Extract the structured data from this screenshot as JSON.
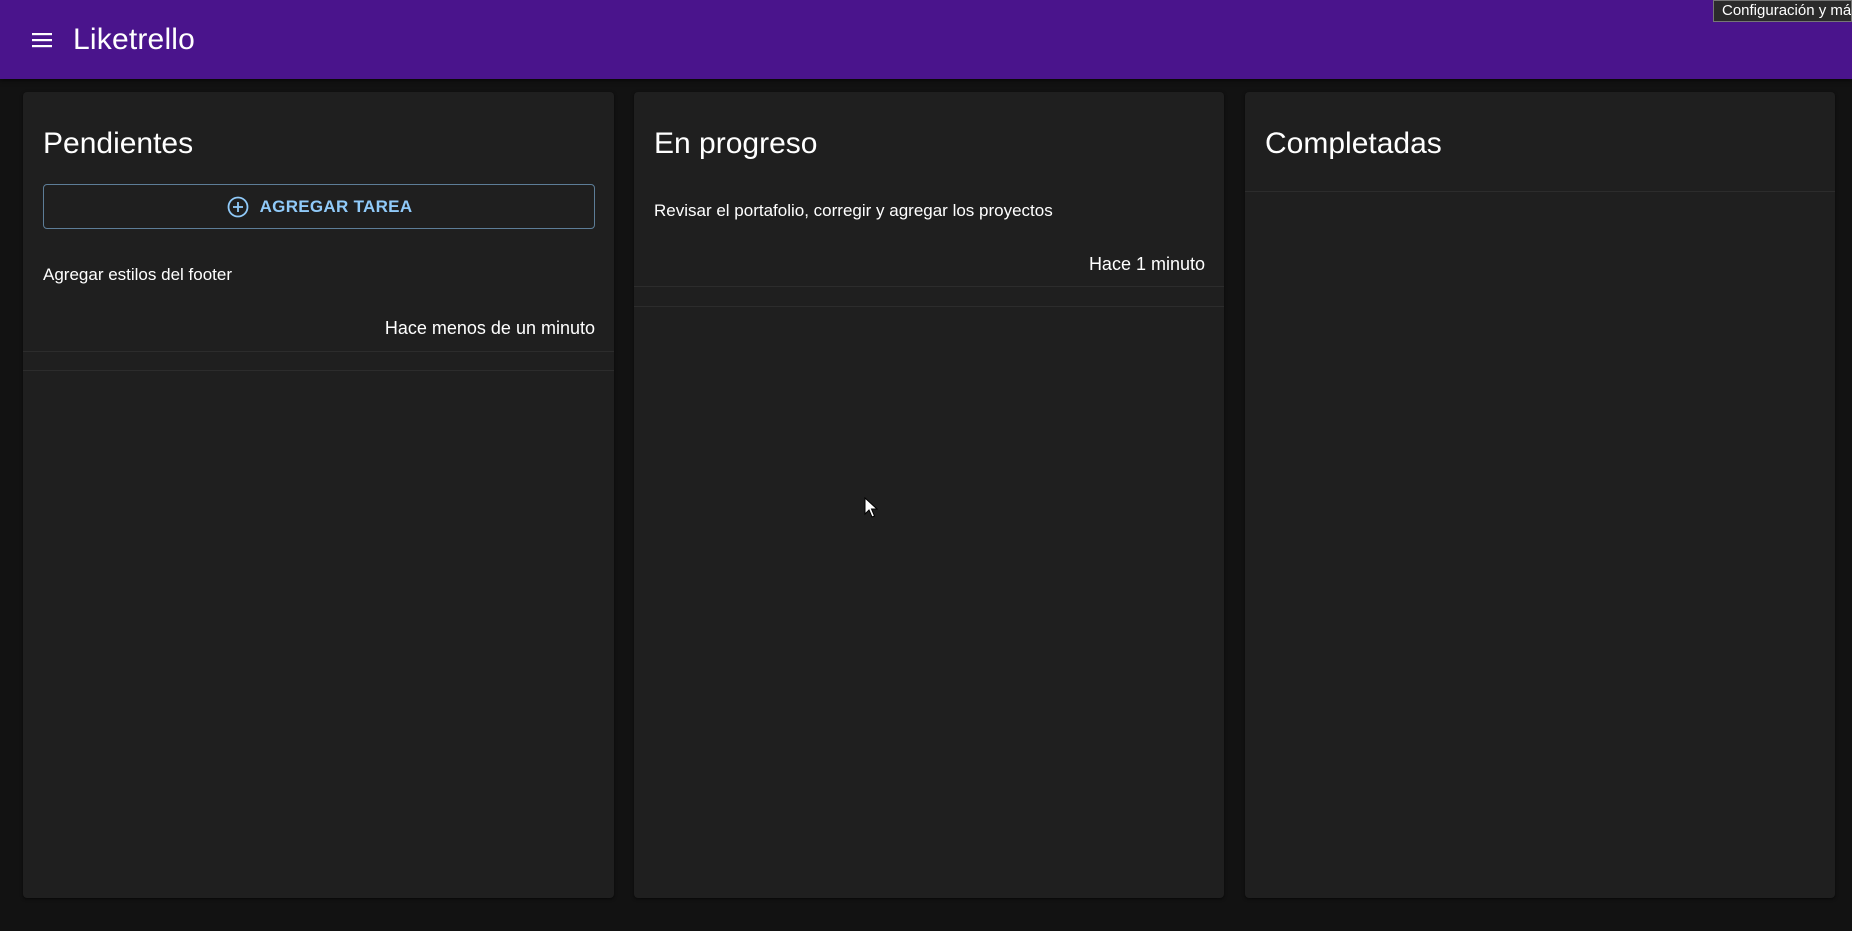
{
  "appbar": {
    "title": "Liketrello",
    "menu_icon": "menu-icon",
    "color": "#4a148c"
  },
  "tooltip": {
    "text": "Configuración y más"
  },
  "columns": [
    {
      "title": "Pendientes",
      "add_button_label": "AGREGAR TAREA",
      "add_icon": "add-circle-icon",
      "tasks": [
        {
          "text": "Agregar estilos del footer",
          "time": "Hace menos de un minuto"
        }
      ]
    },
    {
      "title": "En progreso",
      "tasks": [
        {
          "text": "Revisar el portafolio, corregir y agregar los proyectos",
          "time": "Hace 1 minuto"
        }
      ]
    },
    {
      "title": "Completadas",
      "tasks": []
    }
  ],
  "colors": {
    "background": "#121212",
    "surface": "#1f1f1f",
    "accent": "#90caf9"
  }
}
